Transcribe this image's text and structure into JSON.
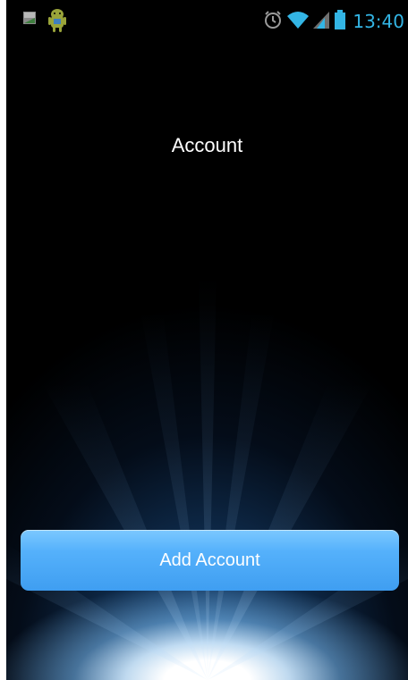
{
  "status_bar": {
    "time": "13:40",
    "clock_color": "#33b5e5",
    "left_icons": [
      "sim-card-3g-icon",
      "android-robot-icon"
    ],
    "right_icons": [
      "alarm-clock-icon",
      "wifi-icon",
      "cell-signal-icon",
      "battery-icon"
    ]
  },
  "screen": {
    "title": "Account"
  },
  "actions": {
    "add_account_label": "Add Account",
    "button_color": "#4aa8f5"
  }
}
